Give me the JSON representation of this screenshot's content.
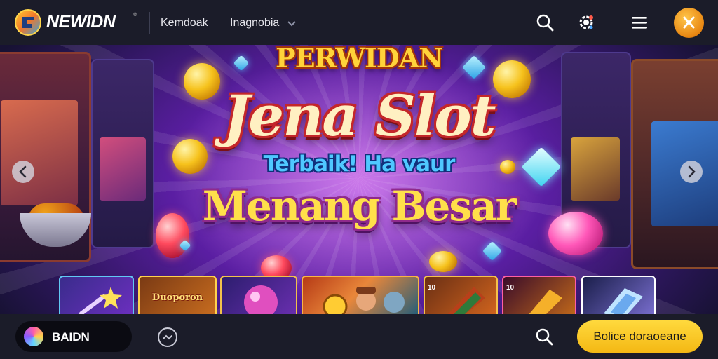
{
  "header": {
    "brand": "NEWIDN",
    "brand_mark": "®",
    "nav": [
      {
        "label": "Kemdoak"
      },
      {
        "label": "Inagnobia"
      }
    ],
    "icons": [
      "search-icon",
      "gear-icon",
      "menu-icon",
      "avatar-icon"
    ],
    "accent": "#f4a322"
  },
  "hero": {
    "kicker": "PERWIDAN",
    "title": "Jena Slot",
    "subtitle": "Terbaik! Ha vaur",
    "cta_text": "Menang Besar",
    "colors": {
      "title": "#fff0c2",
      "kicker": "#ffd33a",
      "subtitle": "#4fc8ff",
      "cta": "#ffe04a"
    },
    "tiles": [
      {
        "label": "",
        "title": ""
      },
      {
        "label": "",
        "title": "Duoporon"
      },
      {
        "label": "",
        "title": ""
      },
      {
        "label": "",
        "title": ""
      },
      {
        "label": "10",
        "title": ""
      },
      {
        "label": "10",
        "title": ""
      },
      {
        "label": "",
        "title": ""
      }
    ]
  },
  "footer": {
    "pill_label": "BAIDN",
    "cta_label": "Bolice doraoeane",
    "cta_color": "#f8c72a"
  }
}
